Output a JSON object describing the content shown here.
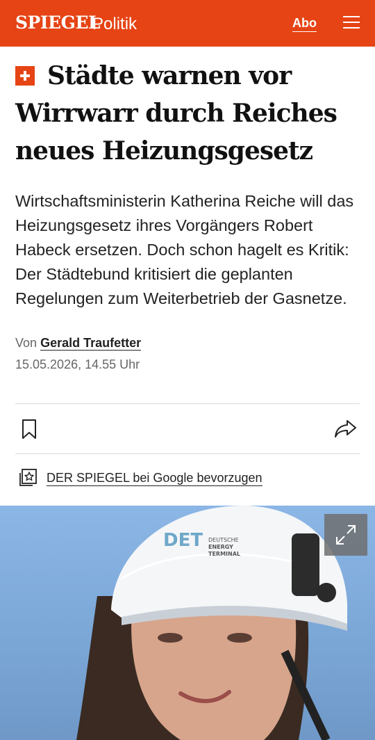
{
  "header": {
    "logo": "SPIEGEL",
    "section": "Politik",
    "abo_label": "Abo",
    "menu_icon": "hamburger-menu-icon",
    "brand_color": "#e64415"
  },
  "article": {
    "premium_icon": "spiegel-plus-icon",
    "headline": "Städte warnen vor Wirrwarr durch Reiches neues Heizungsgesetz",
    "teaser": "Wirtschaftsministerin Katherina Reiche will das Heizungsgesetz ihres Vorgängers Robert Habeck ersetzen. Doch schon hagelt es Kritik: Der Städtebund kritisiert die geplanten Regelungen zum Weiterbetrieb der Gasnetze.",
    "byline_prefix": "Von",
    "author": "Gerald Traufetter",
    "date": "15.05.2026, 14.55 Uhr"
  },
  "actions": {
    "bookmark_icon": "bookmark-icon",
    "share_icon": "share-icon",
    "google_icon": "google-preferred-source-icon",
    "google_label": "DER SPIEGEL bei Google bevorzugen"
  },
  "image": {
    "helmet_text": "DET",
    "helmet_subtext_1": "DEUTSCHE",
    "helmet_subtext_2": "ENERGY",
    "helmet_subtext_3": "TERMINAL",
    "expand_icon": "expand-icon"
  }
}
